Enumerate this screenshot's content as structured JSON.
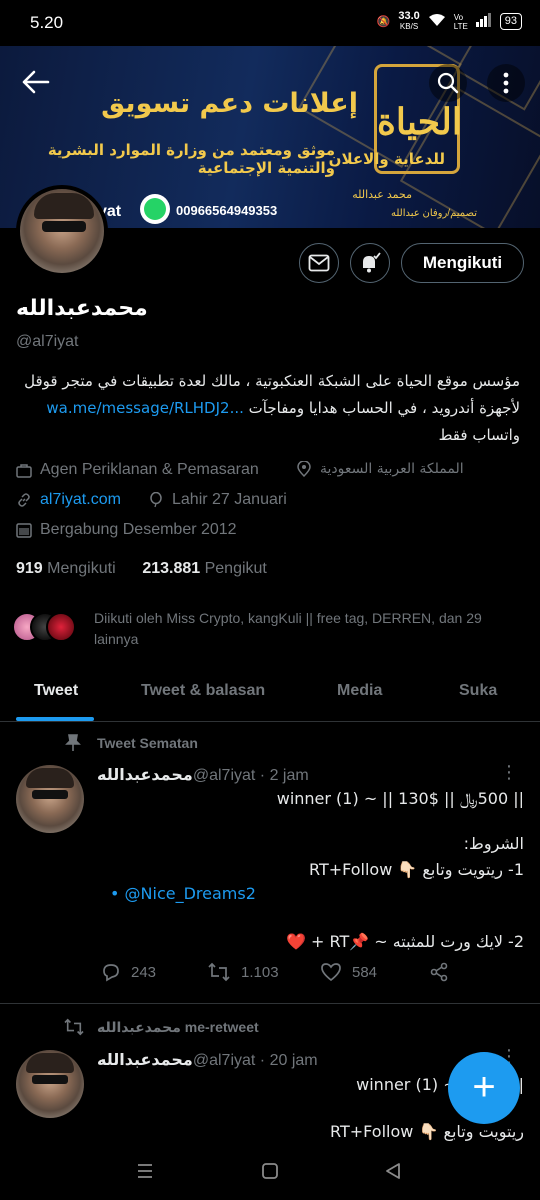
{
  "status_bar": {
    "time": "5.20",
    "net_speed": "33.0",
    "net_unit": "KB/S",
    "volte": "Vo LTE",
    "battery": "93"
  },
  "banner": {
    "title": "إعلانات دعم تسويق",
    "subtitle": "موثق ومعتمد من وزارة الموارد البشرية والتنمية الإجتماعية",
    "logo_text": "الحياة",
    "brand": "للدعاية والاعلان",
    "name": "محمد عبدالله",
    "design_credit": "تصميم/روفان عبدالله",
    "phone": "00966564949353",
    "handle_fragment": "yat"
  },
  "profile": {
    "name": "محمدعبدالله",
    "handle": "@al7iyat",
    "follow_label": "Mengikuti",
    "bio_line1": "مؤسس موقع الحياة على الشبكة العنكبوتية ، مالك لعدة تطبيقات في متجر قوقل",
    "bio_line2_text": "لأجهزة أندرويد ، في الحساب هدايا ومفاجآت",
    "bio_link": "wa.me/message/RLHDJ2...",
    "bio_line3": "واتساب فقط",
    "category": "Agen Periklanan & Pemasaran",
    "location": "المملكة العربية السعودية",
    "website": "al7iyat.com",
    "birthday": "Lahir 27 Januari",
    "joined": "Bergabung Desember 2012",
    "following_count": "919",
    "following_label": "Mengikuti",
    "followers_count": "213.881",
    "followers_label": "Pengikut",
    "followed_by_line1": "Diikuti oleh Miss Crypto, kangKuli || free tag, DERREN, dan 29",
    "followed_by_line2": "lainnya"
  },
  "tabs": [
    "Tweet",
    "Tweet & balasan",
    "Media",
    "Suka"
  ],
  "tweets": [
    {
      "context": "Tweet Sematan",
      "name": "محمدعبدالله",
      "handle": "@al7iyat",
      "time": "· 2 jam",
      "line1": "|| 500﷼ || $130 || ~ (1) winner",
      "line2": "الشروط:",
      "line3": "1- ريتويت وتابع 👇🏻 RT+Follow",
      "mention": "@Nice_Dreams2",
      "line4": "2- لايك ورت للمثبته ~ 📌RT + ❤️",
      "replies": "243",
      "retweets": "1.103",
      "likes": "584"
    },
    {
      "context": "محمدعبدالله me-retweet",
      "name": "محمدعبدالله",
      "handle": "@al7iyat",
      "time": "· 20 jam",
      "line1": "|| 40$ || ~ (1) winner",
      "line2": "ريتويت وتابع 👇🏻 RT+Follow"
    }
  ],
  "fab_label": "+"
}
